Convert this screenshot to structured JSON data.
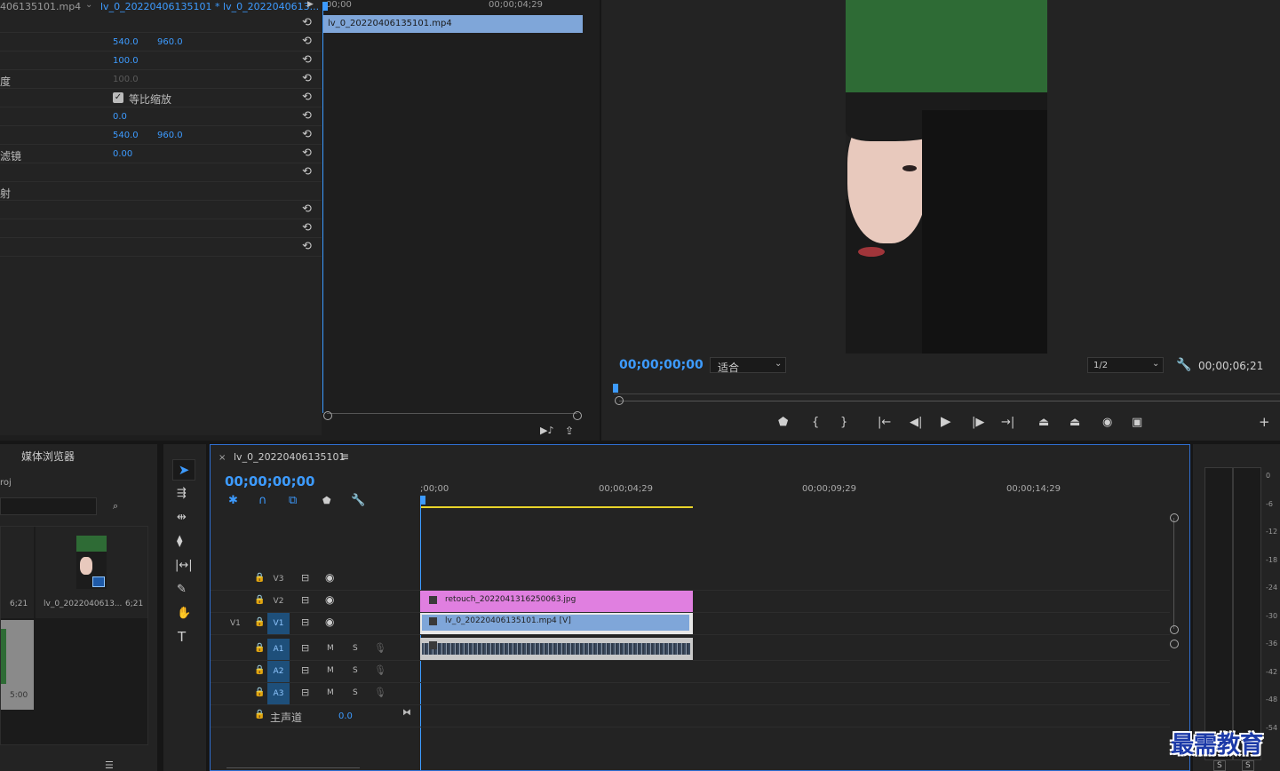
{
  "effect_controls": {
    "tab_source": "406135101.mp4",
    "tab_sequence": "lv_0_20220406135101 * lv_0_2022040613...",
    "ruler_start": "00;00",
    "ruler_end": "00;00;04;29",
    "clip_name": "lv_0_20220406135101.mp4",
    "rows": [
      {
        "label": "",
        "v1": "",
        "v2": ""
      },
      {
        "label": "",
        "v1": "540.0",
        "v2": "960.0"
      },
      {
        "label": "",
        "v1": "100.0",
        "v2": ""
      },
      {
        "label": "度",
        "v1": "100.0",
        "v2": ""
      },
      {
        "label": "",
        "v1": "",
        "v2": ""
      },
      {
        "label": "",
        "v1": "0.0",
        "v2": ""
      },
      {
        "label": "",
        "v1": "540.0",
        "v2": "960.0"
      },
      {
        "label": "滤镜",
        "v1": "0.00",
        "v2": ""
      },
      {
        "label": "",
        "v1": "",
        "v2": ""
      },
      {
        "label": "射",
        "v1": "",
        "v2": ""
      },
      {
        "label": "",
        "v1": "",
        "v2": ""
      },
      {
        "label": "",
        "v1": "",
        "v2": ""
      },
      {
        "label": "",
        "v1": "",
        "v2": ""
      }
    ],
    "uniform_scale_label": "等比缩放",
    "uniform_scale_checked": true
  },
  "program_monitor": {
    "timecode": "00;00;00;00",
    "fit_label": "适合",
    "resolution": "1/2",
    "duration": "00;00;06;21",
    "bg_color": "#2e6b35"
  },
  "project": {
    "tab_media_browser": "媒体浏览器",
    "path": "roj",
    "items": [
      {
        "name": "",
        "duration": "6;21"
      },
      {
        "name": "lv_0_2022040613...",
        "duration": "6;21"
      },
      {
        "name": "",
        "duration": "5:00"
      }
    ]
  },
  "timeline": {
    "sequence_name": "lv_0_20220406135101",
    "timecode": "00;00;00;00",
    "ruler": [
      ";00;00",
      "00;00;04;29",
      "00;00;09;29",
      "00;00;14;29"
    ],
    "tracks_video": [
      {
        "name": "V3",
        "source": ""
      },
      {
        "name": "V2",
        "source": ""
      },
      {
        "name": "V1",
        "source": "V1"
      }
    ],
    "tracks_audio": [
      {
        "name": "A1",
        "m": "M",
        "s": "S"
      },
      {
        "name": "A2",
        "m": "M",
        "s": "S"
      },
      {
        "name": "A3",
        "m": "M",
        "s": "S"
      }
    ],
    "master_label": "主声道",
    "master_value": "0.0",
    "clip_v2": "retouch_2022041316250063.jpg",
    "clip_v1": "lv_0_20220406135101.mp4 [V]",
    "clip_v2_color": "#e07fe0",
    "clip_v1_color": "#7fa6d9"
  },
  "meter": {
    "scale": [
      "0",
      "-6",
      "-12",
      "-18",
      "-24",
      "-30",
      "-36",
      "-42",
      "-48",
      "-54"
    ],
    "solo_left": "S",
    "solo_right": "S"
  },
  "watermark": "最需教育"
}
